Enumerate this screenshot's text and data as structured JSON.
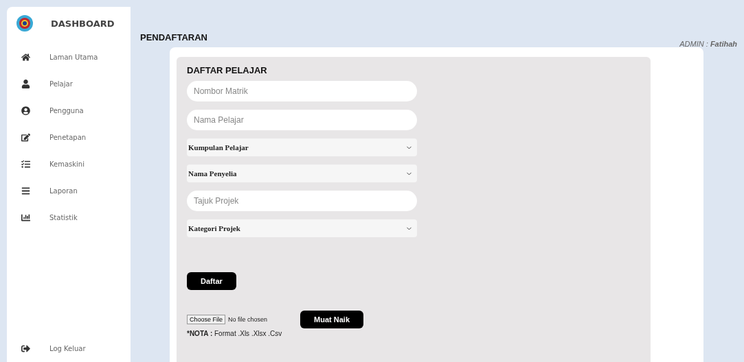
{
  "sidebar": {
    "title": "DASHBOARD",
    "items": [
      {
        "label": "Laman Utama"
      },
      {
        "label": "Pelajar"
      },
      {
        "label": "Pengguna"
      },
      {
        "label": "Penetapan"
      },
      {
        "label": "Kemaskini"
      },
      {
        "label": "Laporan"
      },
      {
        "label": "Statistik"
      }
    ],
    "logout": "Log Keluar"
  },
  "header": {
    "title": "PENDAFTARAN",
    "user": "ADMIN : **Fatihah**"
  },
  "form": {
    "title": "DAFTAR PELAJAR",
    "fields": [
      {
        "kind": "input",
        "placeholder": "Nombor Matrik"
      },
      {
        "kind": "input",
        "placeholder": "Nama Pelajar"
      },
      {
        "kind": "select",
        "value": "Kumpulan Pelajar"
      },
      {
        "kind": "select",
        "value": "Nama Penyelia"
      },
      {
        "kind": "input",
        "placeholder": "Tajuk Projek"
      },
      {
        "kind": "select",
        "value": "Kategori Projek"
      }
    ],
    "submit": "Daftar",
    "file_button": "Choose File",
    "file_status": "No file chosen",
    "upload": "Muat Naik",
    "note_label": "*NOTA :",
    "note_text": "Format .Xls .Xlsx .Csv"
  }
}
